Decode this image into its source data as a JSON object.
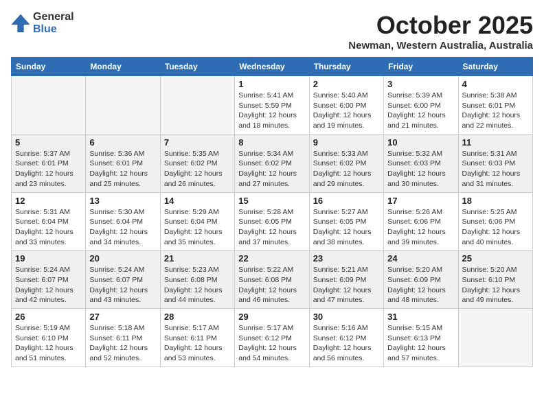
{
  "header": {
    "logo_general": "General",
    "logo_blue": "Blue",
    "month_title": "October 2025",
    "location": "Newman, Western Australia, Australia"
  },
  "weekdays": [
    "Sunday",
    "Monday",
    "Tuesday",
    "Wednesday",
    "Thursday",
    "Friday",
    "Saturday"
  ],
  "weeks": [
    [
      {
        "day": "",
        "info": ""
      },
      {
        "day": "",
        "info": ""
      },
      {
        "day": "",
        "info": ""
      },
      {
        "day": "1",
        "info": "Sunrise: 5:41 AM\nSunset: 5:59 PM\nDaylight: 12 hours\nand 18 minutes."
      },
      {
        "day": "2",
        "info": "Sunrise: 5:40 AM\nSunset: 6:00 PM\nDaylight: 12 hours\nand 19 minutes."
      },
      {
        "day": "3",
        "info": "Sunrise: 5:39 AM\nSunset: 6:00 PM\nDaylight: 12 hours\nand 21 minutes."
      },
      {
        "day": "4",
        "info": "Sunrise: 5:38 AM\nSunset: 6:01 PM\nDaylight: 12 hours\nand 22 minutes."
      }
    ],
    [
      {
        "day": "5",
        "info": "Sunrise: 5:37 AM\nSunset: 6:01 PM\nDaylight: 12 hours\nand 23 minutes."
      },
      {
        "day": "6",
        "info": "Sunrise: 5:36 AM\nSunset: 6:01 PM\nDaylight: 12 hours\nand 25 minutes."
      },
      {
        "day": "7",
        "info": "Sunrise: 5:35 AM\nSunset: 6:02 PM\nDaylight: 12 hours\nand 26 minutes."
      },
      {
        "day": "8",
        "info": "Sunrise: 5:34 AM\nSunset: 6:02 PM\nDaylight: 12 hours\nand 27 minutes."
      },
      {
        "day": "9",
        "info": "Sunrise: 5:33 AM\nSunset: 6:02 PM\nDaylight: 12 hours\nand 29 minutes."
      },
      {
        "day": "10",
        "info": "Sunrise: 5:32 AM\nSunset: 6:03 PM\nDaylight: 12 hours\nand 30 minutes."
      },
      {
        "day": "11",
        "info": "Sunrise: 5:31 AM\nSunset: 6:03 PM\nDaylight: 12 hours\nand 31 minutes."
      }
    ],
    [
      {
        "day": "12",
        "info": "Sunrise: 5:31 AM\nSunset: 6:04 PM\nDaylight: 12 hours\nand 33 minutes."
      },
      {
        "day": "13",
        "info": "Sunrise: 5:30 AM\nSunset: 6:04 PM\nDaylight: 12 hours\nand 34 minutes."
      },
      {
        "day": "14",
        "info": "Sunrise: 5:29 AM\nSunset: 6:04 PM\nDaylight: 12 hours\nand 35 minutes."
      },
      {
        "day": "15",
        "info": "Sunrise: 5:28 AM\nSunset: 6:05 PM\nDaylight: 12 hours\nand 37 minutes."
      },
      {
        "day": "16",
        "info": "Sunrise: 5:27 AM\nSunset: 6:05 PM\nDaylight: 12 hours\nand 38 minutes."
      },
      {
        "day": "17",
        "info": "Sunrise: 5:26 AM\nSunset: 6:06 PM\nDaylight: 12 hours\nand 39 minutes."
      },
      {
        "day": "18",
        "info": "Sunrise: 5:25 AM\nSunset: 6:06 PM\nDaylight: 12 hours\nand 40 minutes."
      }
    ],
    [
      {
        "day": "19",
        "info": "Sunrise: 5:24 AM\nSunset: 6:07 PM\nDaylight: 12 hours\nand 42 minutes."
      },
      {
        "day": "20",
        "info": "Sunrise: 5:24 AM\nSunset: 6:07 PM\nDaylight: 12 hours\nand 43 minutes."
      },
      {
        "day": "21",
        "info": "Sunrise: 5:23 AM\nSunset: 6:08 PM\nDaylight: 12 hours\nand 44 minutes."
      },
      {
        "day": "22",
        "info": "Sunrise: 5:22 AM\nSunset: 6:08 PM\nDaylight: 12 hours\nand 46 minutes."
      },
      {
        "day": "23",
        "info": "Sunrise: 5:21 AM\nSunset: 6:09 PM\nDaylight: 12 hours\nand 47 minutes."
      },
      {
        "day": "24",
        "info": "Sunrise: 5:20 AM\nSunset: 6:09 PM\nDaylight: 12 hours\nand 48 minutes."
      },
      {
        "day": "25",
        "info": "Sunrise: 5:20 AM\nSunset: 6:10 PM\nDaylight: 12 hours\nand 49 minutes."
      }
    ],
    [
      {
        "day": "26",
        "info": "Sunrise: 5:19 AM\nSunset: 6:10 PM\nDaylight: 12 hours\nand 51 minutes."
      },
      {
        "day": "27",
        "info": "Sunrise: 5:18 AM\nSunset: 6:11 PM\nDaylight: 12 hours\nand 52 minutes."
      },
      {
        "day": "28",
        "info": "Sunrise: 5:17 AM\nSunset: 6:11 PM\nDaylight: 12 hours\nand 53 minutes."
      },
      {
        "day": "29",
        "info": "Sunrise: 5:17 AM\nSunset: 6:12 PM\nDaylight: 12 hours\nand 54 minutes."
      },
      {
        "day": "30",
        "info": "Sunrise: 5:16 AM\nSunset: 6:12 PM\nDaylight: 12 hours\nand 56 minutes."
      },
      {
        "day": "31",
        "info": "Sunrise: 5:15 AM\nSunset: 6:13 PM\nDaylight: 12 hours\nand 57 minutes."
      },
      {
        "day": "",
        "info": ""
      }
    ]
  ]
}
